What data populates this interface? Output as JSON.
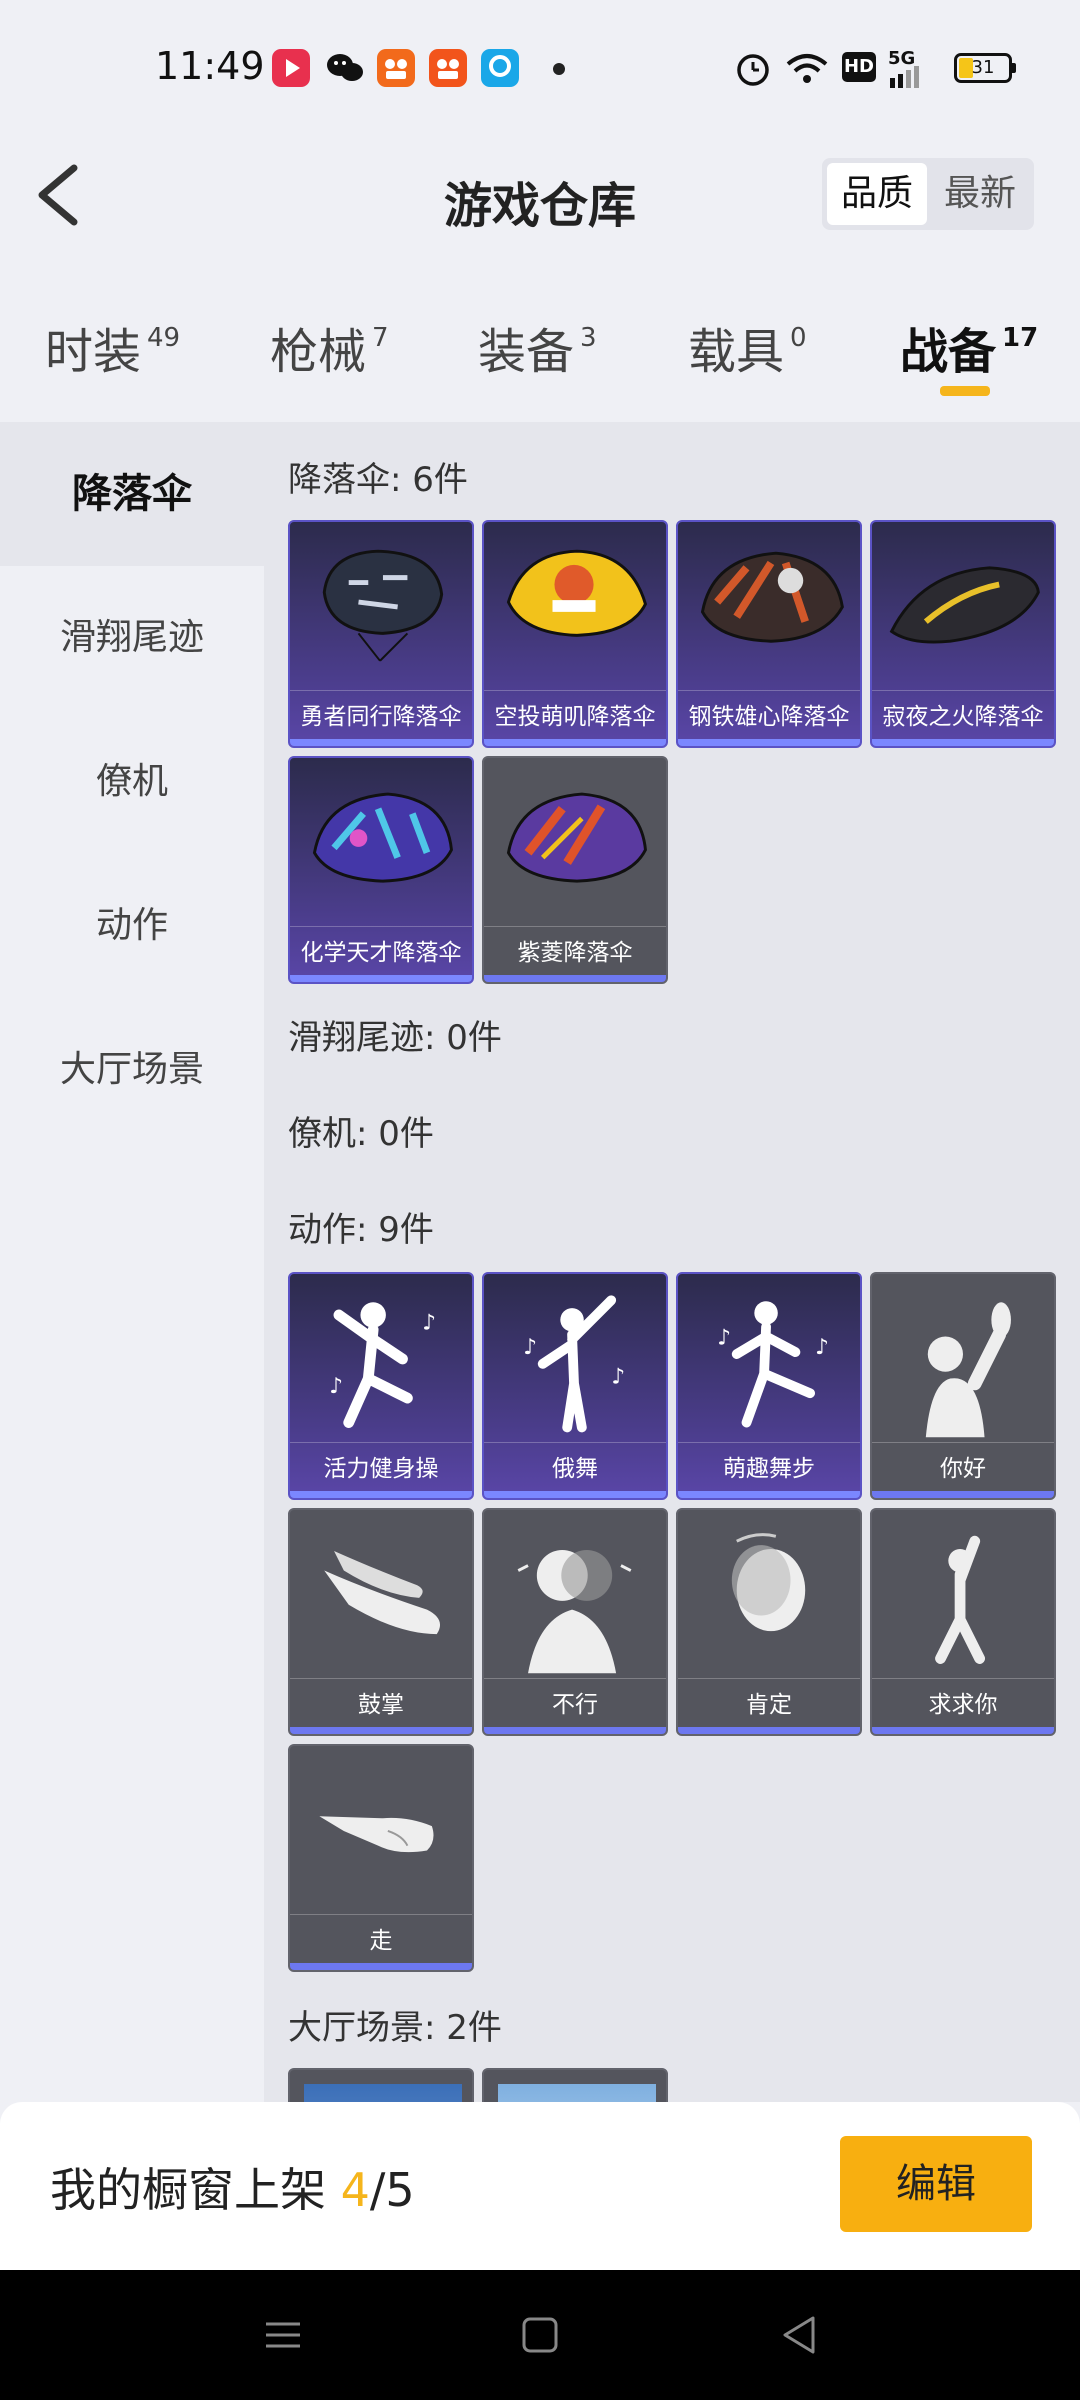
{
  "status_bar": {
    "time": "11:49",
    "battery": "31",
    "network": "5G",
    "hd": "HD",
    "icons": [
      "video-app-icon",
      "wechat-icon",
      "app-icon-orange",
      "app-icon-orange-2",
      "app-icon-blue",
      "alarm-icon",
      "wifi-icon",
      "hd-icon",
      "signal-icon",
      "battery-icon"
    ]
  },
  "header": {
    "title": "游戏仓库",
    "sort_options": [
      "品质",
      "最新"
    ],
    "sort_selected": "品质"
  },
  "tabs": [
    {
      "label": "时装",
      "count": "49"
    },
    {
      "label": "枪械",
      "count": "7"
    },
    {
      "label": "装备",
      "count": "3"
    },
    {
      "label": "载具",
      "count": "0"
    },
    {
      "label": "战备",
      "count": "17"
    }
  ],
  "active_tab": "战备",
  "sidebar": {
    "items": [
      "降落伞",
      "滑翔尾迹",
      "僚机",
      "动作",
      "大厅场景"
    ],
    "active": "降落伞"
  },
  "sections": {
    "parachute": {
      "title": "降落伞: 6件",
      "items": [
        "勇者同行降落伞",
        "空投萌叽降落伞",
        "钢铁雄心降落伞",
        "寂夜之火降落伞",
        "化学天才降落伞",
        "紫菱降落伞"
      ]
    },
    "glide_trail": {
      "title": "滑翔尾迹: 0件"
    },
    "wingman": {
      "title": "僚机: 0件"
    },
    "emotes": {
      "title": "动作: 9件",
      "items": [
        "活力健身操",
        "俄舞",
        "萌趣舞步",
        "你好",
        "鼓掌",
        "不行",
        "肯定",
        "求求你",
        "走"
      ]
    },
    "lobby": {
      "title": "大厅场景: 2件"
    }
  },
  "bottom": {
    "showcase_prefix": "我的橱窗上架 ",
    "showcase_current": "4",
    "showcase_total": "/5",
    "edit_label": "编辑"
  },
  "colors": {
    "accent": "#f5b51c",
    "button": "#f8af10",
    "purple_card": "#4b3d8c",
    "gray_card": "#54555d"
  }
}
